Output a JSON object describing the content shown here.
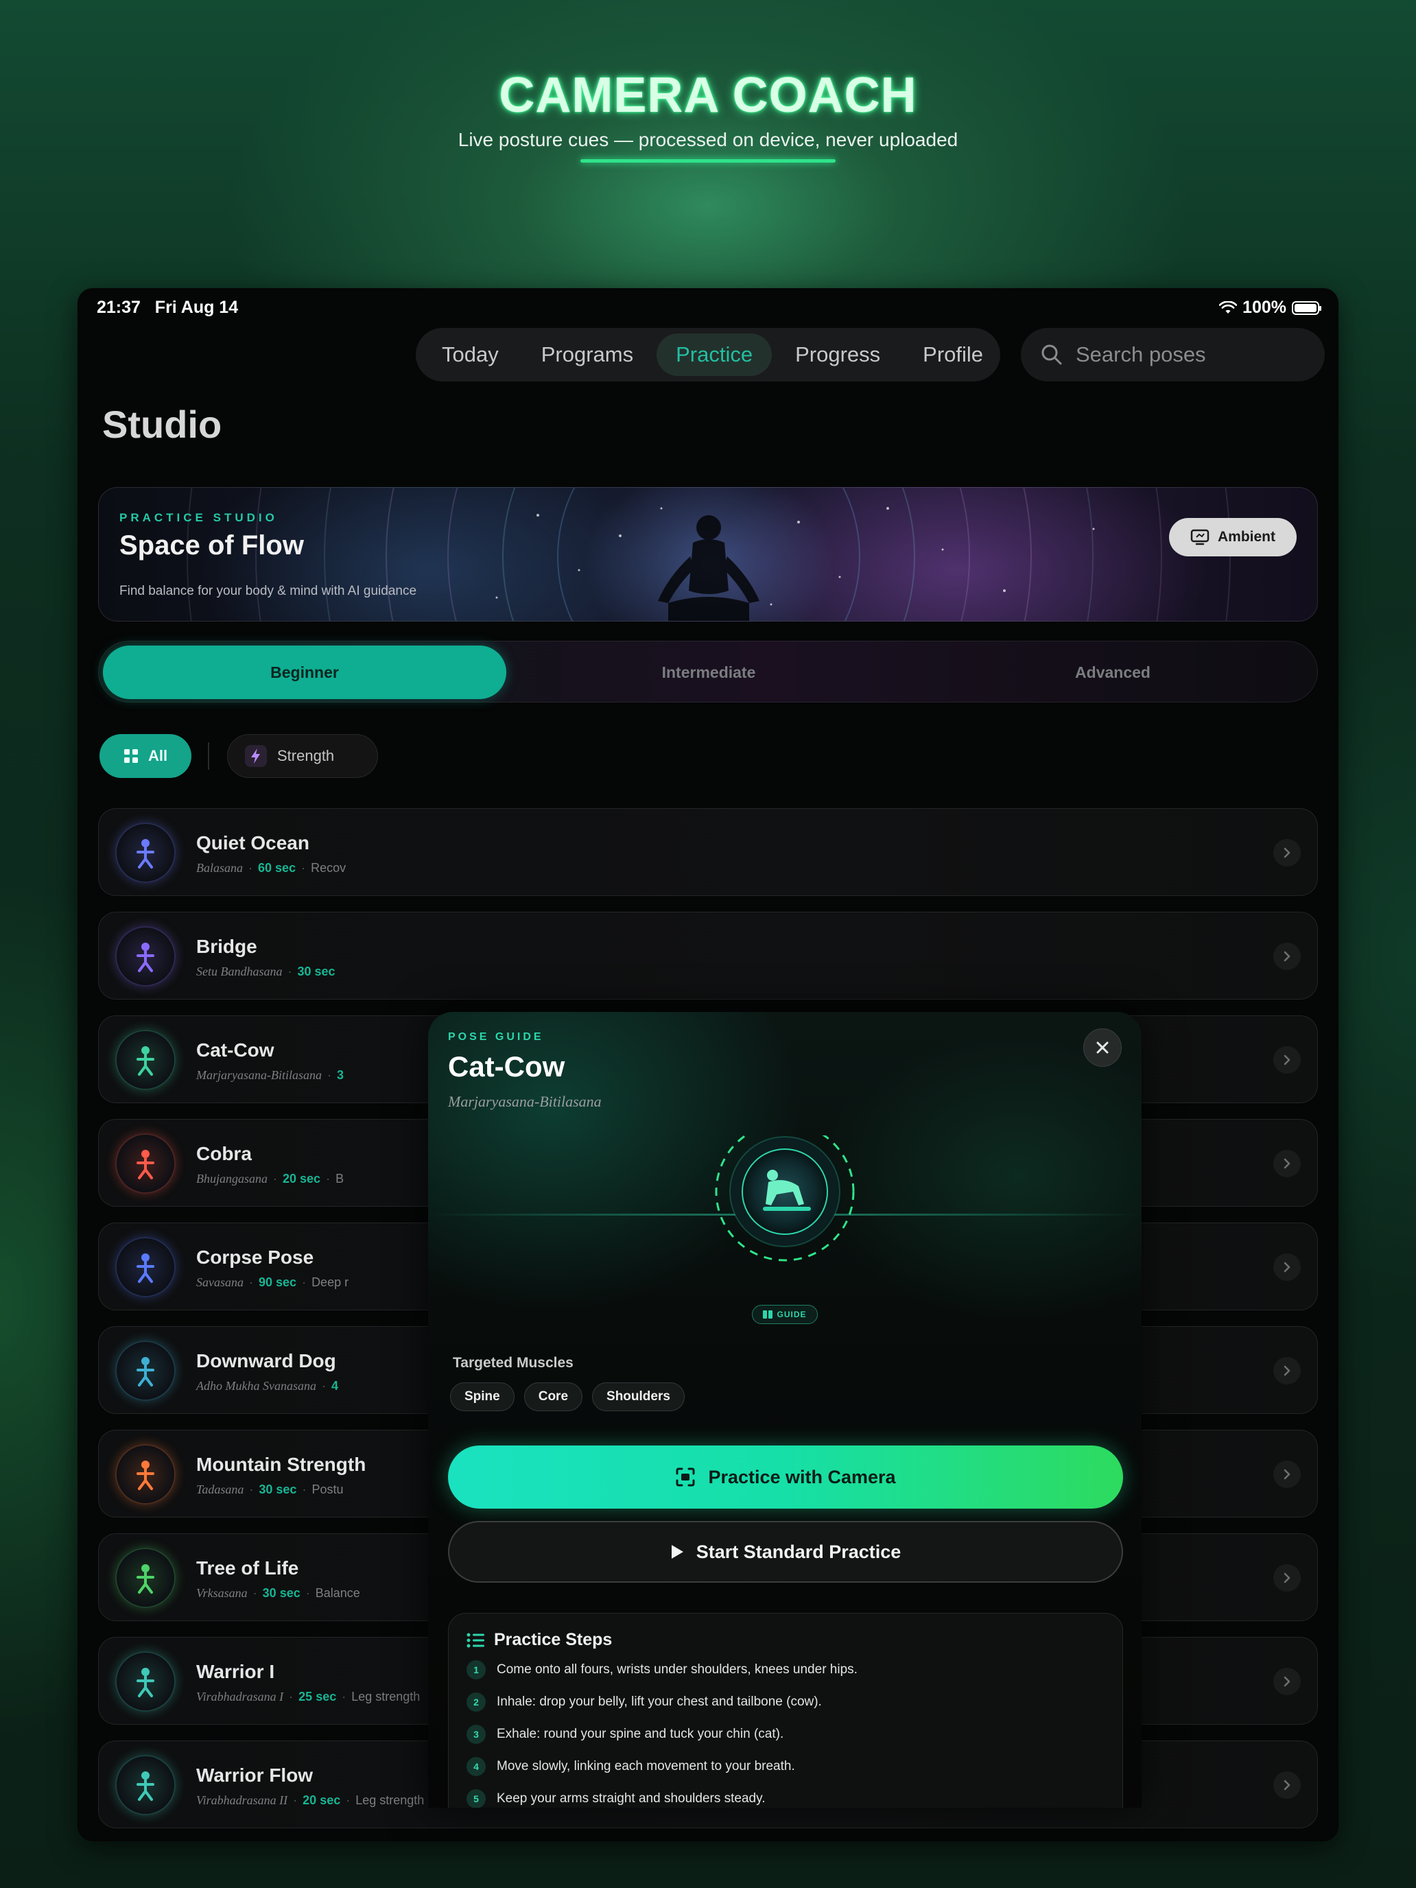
{
  "hero": {
    "title": "CAMERA COACH",
    "subtitle": "Live posture cues — processed on device, never uploaded"
  },
  "status_bar": {
    "time": "21:37",
    "date": "Fri Aug 14",
    "battery": "100%"
  },
  "nav": {
    "tabs": [
      {
        "label": "Today",
        "active": false
      },
      {
        "label": "Programs",
        "active": false
      },
      {
        "label": "Practice",
        "active": true
      },
      {
        "label": "Progress",
        "active": false
      },
      {
        "label": "Profile",
        "active": false
      }
    ],
    "search_placeholder": "Search poses"
  },
  "page_title": "Studio",
  "banner": {
    "kicker": "PRACTICE STUDIO",
    "title": "Space of Flow",
    "description": "Find balance for your body & mind with AI guidance",
    "ambient_label": "Ambient"
  },
  "levels": [
    {
      "label": "Beginner",
      "active": true
    },
    {
      "label": "Intermediate",
      "active": false
    },
    {
      "label": "Advanced",
      "active": false
    }
  ],
  "filters": {
    "all_label": "All",
    "strength_label": "Strength"
  },
  "poses": [
    {
      "name": "Quiet Ocean",
      "sanskrit": "Balasana",
      "duration": "60 sec",
      "tag": "Recov",
      "color": "#6b7bff"
    },
    {
      "name": "Bridge",
      "sanskrit": "Setu Bandhasana",
      "duration": "30 sec",
      "tag": "",
      "color": "#8a6bff"
    },
    {
      "name": "Cat-Cow",
      "sanskrit": "Marjaryasana-Bitilasana",
      "duration": "3",
      "tag": "",
      "color": "#3fd3a0"
    },
    {
      "name": "Cobra",
      "sanskrit": "Bhujangasana",
      "duration": "20 sec",
      "tag": "B",
      "color": "#ff5a4a"
    },
    {
      "name": "Corpse Pose",
      "sanskrit": "Savasana",
      "duration": "90 sec",
      "tag": "Deep r",
      "color": "#5a7bff"
    },
    {
      "name": "Downward Dog",
      "sanskrit": "Adho Mukha Svanasana",
      "duration": "4",
      "tag": "",
      "color": "#3fb0d3"
    },
    {
      "name": "Mountain Strength",
      "sanskrit": "Tadasana",
      "duration": "30 sec",
      "tag": "Postu",
      "color": "#ff7a3a"
    },
    {
      "name": "Tree of Life",
      "sanskrit": "Vrksasana",
      "duration": "30 sec",
      "tag": "Balance",
      "color": "#4fd36a"
    },
    {
      "name": "Warrior I",
      "sanskrit": "Virabhadrasana I",
      "duration": "25 sec",
      "tag": "Leg strength",
      "color": "#3fc9b8"
    },
    {
      "name": "Warrior Flow",
      "sanskrit": "Virabhadrasana II",
      "duration": "20 sec",
      "tag": "Leg strength",
      "color": "#3fc9b8"
    }
  ],
  "modal": {
    "kicker": "POSE GUIDE",
    "title": "Cat-Cow",
    "sanskrit": "Marjaryasana-Bitilasana",
    "guide_badge": "GUIDE",
    "muscles_label": "Targeted Muscles",
    "muscles": [
      "Spine",
      "Core",
      "Shoulders"
    ],
    "camera_button": "Practice with Camera",
    "standard_button": "Start Standard Practice",
    "steps_title": "Practice Steps",
    "steps": [
      "Come onto all fours, wrists under shoulders, knees under hips.",
      "Inhale: drop your belly, lift your chest and tailbone (cow).",
      "Exhale: round your spine and tuck your chin (cat).",
      "Move slowly, linking each movement to your breath.",
      "Keep your arms straight and shoulders steady."
    ]
  },
  "colors": {
    "accent": "#1ae2c0",
    "accent_green": "#2ddb5e",
    "active_tab": "#22bfa1"
  }
}
